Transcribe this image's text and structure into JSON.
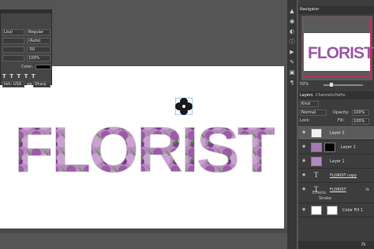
{
  "character_panel": {
    "font_style_left": "Lisz/",
    "font_style": "Regular",
    "leading": "(Auto)",
    "tracking": "-50",
    "scale": "100%",
    "color_label": "Color:",
    "color": "#000000",
    "language": "lish: USA",
    "anti_alias_prefix": "aa",
    "anti_alias": "Sharp"
  },
  "artwork": {
    "title_text": "FLORIST",
    "letter_color": "#9c5aa8",
    "leaf_color": "#4f8a3c",
    "flower_ornament": "clover-flower-shape"
  },
  "navigator": {
    "tab_label": "Navigator",
    "thumbnail_text": "FLORIST",
    "zoom": "50%"
  },
  "layers": {
    "tabs": [
      "Layers",
      "Channels",
      "Paths"
    ],
    "kind_filter": "Kind",
    "blend_mode": "Normal",
    "opacity_label": "Opacity:",
    "opacity": "100%",
    "lock_label": "Lock:",
    "fill_label": "Fill:",
    "fill": "100%",
    "rows": [
      {
        "name": "Layer 2",
        "type": "pixel",
        "selected": true
      },
      {
        "name": "Layer 1",
        "type": "pixel-mask",
        "selected": false
      },
      {
        "name": "Layer 1",
        "type": "pixel",
        "selected": false
      },
      {
        "name": "FLORIST copy",
        "type": "text",
        "selected": false
      },
      {
        "name": "FLORIST",
        "type": "text",
        "selected": false
      },
      {
        "name": "Color Fill 1",
        "type": "fill",
        "selected": false
      }
    ],
    "effects_label": "Effects",
    "stroke_label": "Stroke",
    "fx_label": "fx"
  },
  "icons": {
    "tools": [
      "arrow-up-icon",
      "paint-icon",
      "adjust-icon",
      "info-icon",
      "play-icon",
      "brush-icon",
      "stamp-icon",
      "text-paragraph-icon"
    ]
  }
}
